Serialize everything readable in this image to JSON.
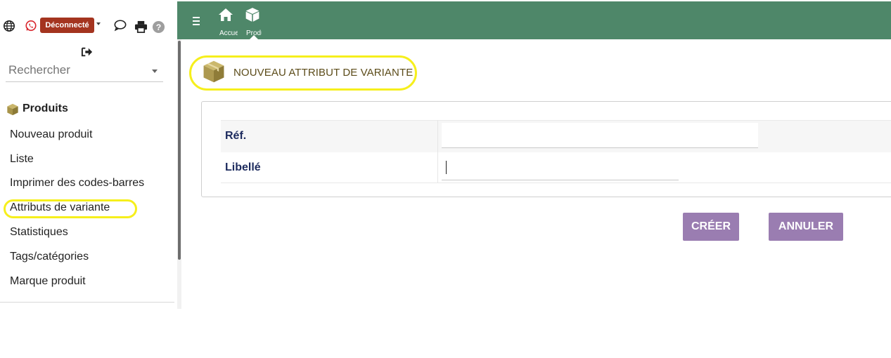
{
  "left_panel": {
    "status_badge": "Déconnecté",
    "search": {
      "placeholder": "Rechercher"
    },
    "menu": {
      "title": "Produits",
      "items": [
        "Nouveau produit",
        "Liste",
        "Imprimer des codes-barres",
        "Attributs de variante",
        "Statistiques",
        "Tags/catégories",
        "Marque produit"
      ],
      "highlighted_item": "Attributs de variante"
    }
  },
  "topbar": {
    "buttons": [
      {
        "label": "Accueil",
        "icon": "home-icon"
      },
      {
        "label": "Produits",
        "icon": "box-icon"
      }
    ],
    "colors": {
      "background": "#4e8769"
    }
  },
  "page": {
    "title": "NOUVEAU ATTRIBUT DE VARIANTE",
    "form": {
      "fields": [
        {
          "label": "Réf.",
          "value": ""
        },
        {
          "label": "Libellé",
          "value": ""
        }
      ]
    },
    "actions": {
      "create_label": "CRÉER",
      "cancel_label": "ANNULER"
    }
  },
  "colors": {
    "accent_button": "#9a7db1",
    "highlight": "#f6ef1c",
    "badge": "#a4341f",
    "label_text": "#1d2b5e"
  }
}
